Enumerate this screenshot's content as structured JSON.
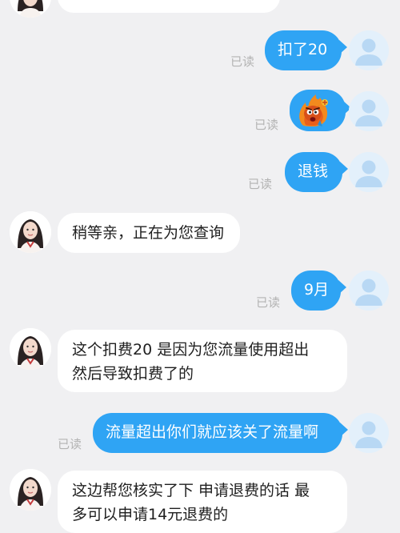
{
  "read_label": "已读",
  "colors": {
    "outgoing_bubble": "#2fa4f4",
    "incoming_bubble": "#ffffff",
    "background": "#f0f0f2",
    "read_text": "#b3b3b3"
  },
  "messages": [
    {
      "direction": "in",
      "type": "text",
      "text": ""
    },
    {
      "direction": "out",
      "type": "text",
      "text": "扣了20",
      "read": true
    },
    {
      "direction": "out",
      "type": "sticker",
      "icon": "angry-fire-emoji-icon",
      "read": true
    },
    {
      "direction": "out",
      "type": "text",
      "text": "退钱",
      "read": true
    },
    {
      "direction": "in",
      "type": "text",
      "text": "稍等亲，正在为您查询"
    },
    {
      "direction": "out",
      "type": "text",
      "text": "9月",
      "read": true
    },
    {
      "direction": "in",
      "type": "text",
      "lines": [
        "这个扣费20 是因为您流量使用超出",
        "然后导致扣费了的"
      ]
    },
    {
      "direction": "out",
      "type": "text",
      "text": "流量超出你们就应该关了流量啊",
      "read": true
    },
    {
      "direction": "in",
      "type": "text",
      "lines": [
        "这边帮您核实了下 申请退费的话 最",
        "多可以申请14元退费的"
      ]
    }
  ]
}
